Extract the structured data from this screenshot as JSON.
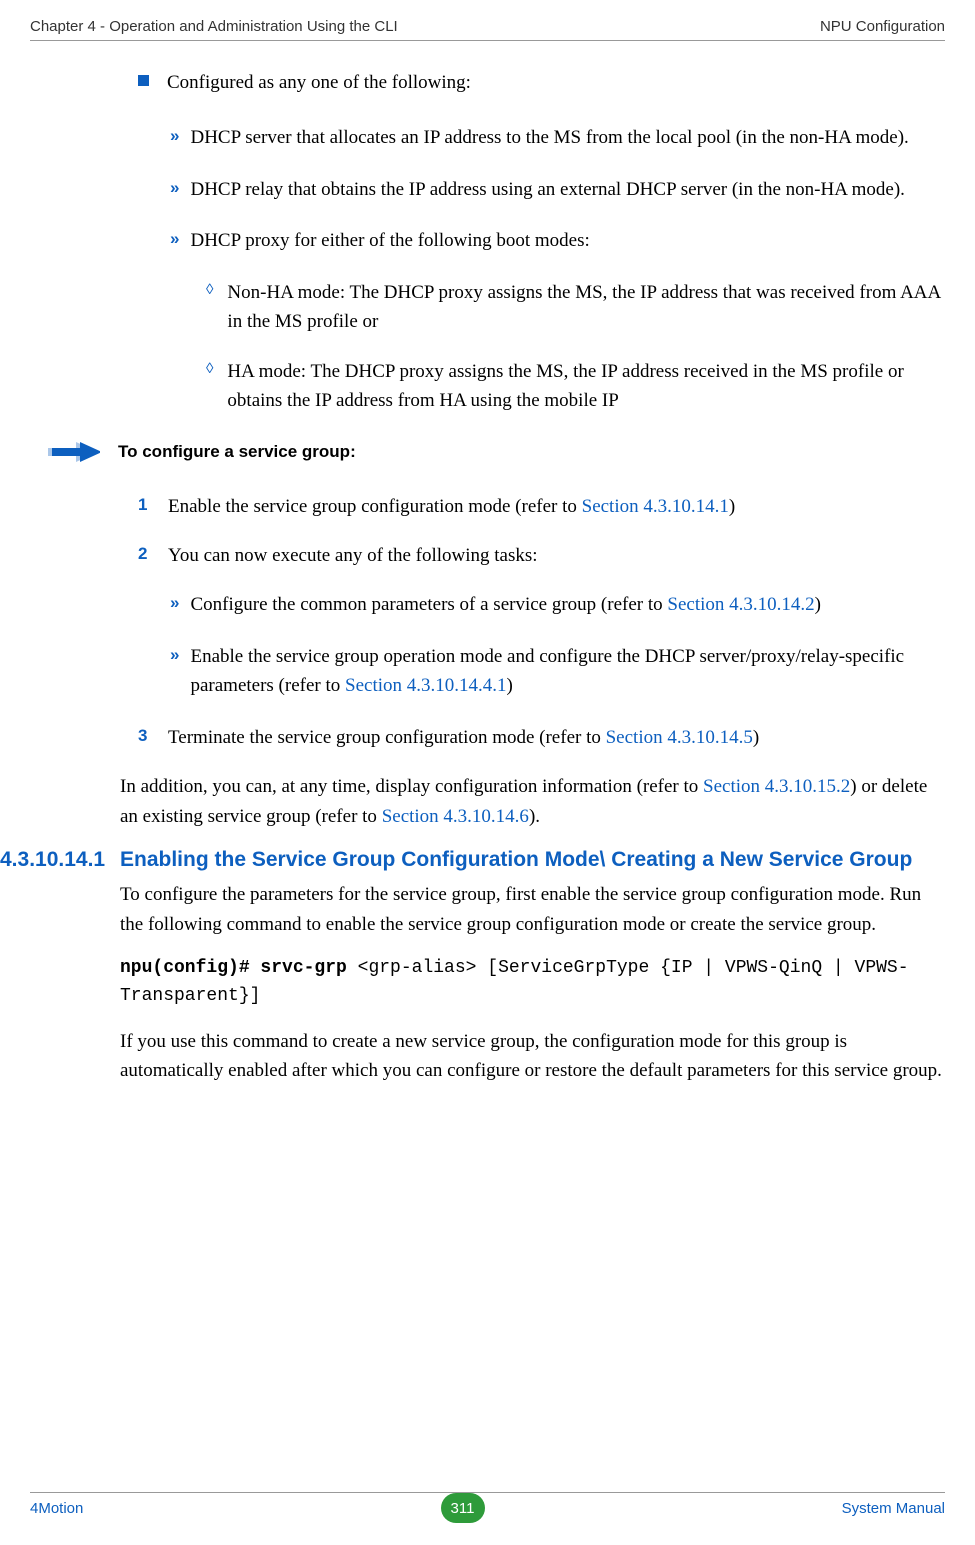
{
  "header": {
    "left": "Chapter 4 - Operation and Administration Using the CLI",
    "right": "NPU Configuration"
  },
  "bullet1": "Configured as any one of the following:",
  "sub": {
    "a": "DHCP server that allocates an IP address to the MS from the local pool (in the non-HA mode).",
    "b": "DHCP relay that obtains the IP address using an external DHCP server (in the non-HA mode).",
    "c": "DHCP proxy for either of the following boot modes:",
    "c1": "Non-HA mode: The DHCP proxy assigns the MS, the IP address that was received from AAA in the MS profile or",
    "c2": "HA mode: The DHCP proxy assigns the MS, the IP address received in the MS profile or obtains the IP address from HA using the mobile IP"
  },
  "proc_title": "To configure a service group:",
  "step1_pre": "Enable the service group configuration mode (refer to ",
  "step1_link": "Section 4.3.10.14.1",
  "step1_post": ")",
  "step2": "You can now execute any of the following tasks:",
  "step2a_pre": "Configure the common parameters of a service group (refer to ",
  "step2a_link": "Section 4.3.10.14.2",
  "step2a_post": ")",
  "step2b_pre": "Enable the service group operation mode and configure the DHCP server/proxy/relay-specific parameters (refer to ",
  "step2b_link": "Section 4.3.10.14.4.1",
  "step2b_post": ")",
  "step3_pre": "Terminate the service group configuration mode (refer to ",
  "step3_link": "Section 4.3.10.14.5",
  "step3_post": ")",
  "addl_1": "In addition, you can, at any time, display configuration information (refer to ",
  "addl_link1": "Section 4.3.10.15.2",
  "addl_2": ") or delete an existing service group (refer to ",
  "addl_link2": "Section 4.3.10.14.6",
  "addl_3": ").",
  "sec_num": "4.3.10.14.1",
  "sec_title": "Enabling the Service Group Configuration Mode\\ Creating a New Service Group",
  "sec_p1": "To configure the parameters for the service group, first enable the service group configuration mode. Run the following command to enable the service group configuration mode or create the service group.",
  "cmd_bold": "npu(config)# srvc-grp ",
  "cmd_rest": "<grp-alias> [ServiceGrpType {IP | VPWS-QinQ | VPWS-Transparent}]",
  "sec_p2": "If you use this command to create a new service group, the configuration mode for this group is automatically enabled after which you can configure or restore the default parameters for this service group.",
  "footer": {
    "left": "4Motion",
    "page": "311",
    "right": "System Manual"
  }
}
